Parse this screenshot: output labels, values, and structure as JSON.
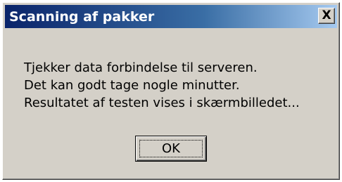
{
  "window": {
    "title": "Scanning af pakker",
    "close_label": "X"
  },
  "message": {
    "lines": [
      "Tjekker data forbindelse til serveren.",
      "Det kan godt tage nogle minutter.",
      "Resultatet af testen vises i skærmbilledet..."
    ]
  },
  "buttons": {
    "ok_label": "OK"
  },
  "colors": {
    "dialog_background": "#d4d0c8",
    "titlebar_start": "#0a246a",
    "titlebar_end": "#a6caf0",
    "title_text": "#ffffff"
  }
}
